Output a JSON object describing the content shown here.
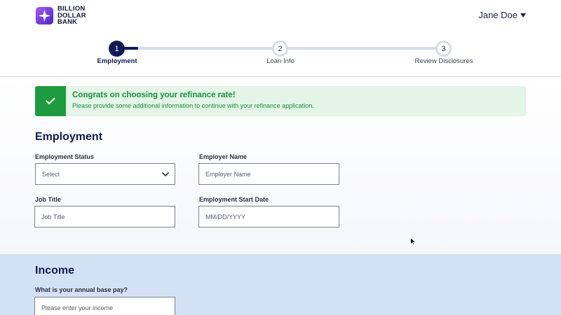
{
  "brand": {
    "name_lines": [
      "BILLION",
      "DOLLAR",
      "BANK"
    ],
    "logo_icon": "sparkle-hexagon-icon",
    "colors": {
      "primary": "#101a54",
      "accent": "#7a3be8",
      "success": "#1e9b3e"
    }
  },
  "user": {
    "name": "Jane Doe"
  },
  "stepper": {
    "steps": [
      {
        "number": "1",
        "label": "Employment",
        "state": "active"
      },
      {
        "number": "2",
        "label": "Loan Info",
        "state": "inactive"
      },
      {
        "number": "3",
        "label": "Review Disclosures",
        "state": "inactive"
      }
    ]
  },
  "alert": {
    "icon": "checkmark-icon",
    "title": "Congrats on choosing your refinance rate!",
    "message": "Please provide some additional information to continue with your refinance application."
  },
  "employment": {
    "title": "Employment",
    "status": {
      "label": "Employment Status",
      "value": "Select"
    },
    "employer": {
      "label": "Employer Name",
      "placeholder": "Employer Name"
    },
    "job_title": {
      "label": "Job Title",
      "placeholder": "Job Title"
    },
    "start_date": {
      "label": "Employment Start Date",
      "placeholder": "MM/DD/YYYY"
    }
  },
  "income": {
    "title": "Income",
    "base_pay": {
      "label": "What is your annual base pay?",
      "placeholder": "Please enter your income"
    }
  }
}
